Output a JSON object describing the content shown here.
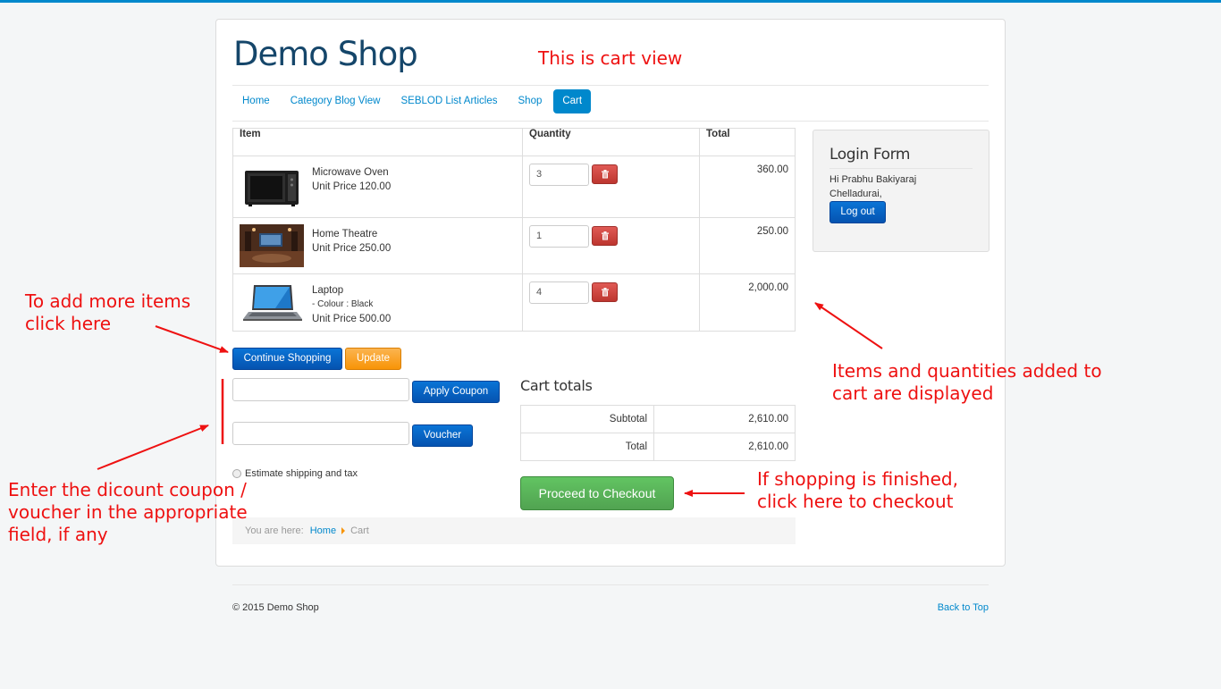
{
  "site": {
    "brand": "Demo Shop"
  },
  "nav": [
    "Home",
    "Category Blog View",
    "SEBLOD List Articles",
    "Shop",
    "Cart"
  ],
  "cart": {
    "headers": {
      "item": "Item",
      "quantity": "Quantity",
      "total": "Total"
    },
    "rows": [
      {
        "name": "Microwave Oven",
        "option": "",
        "unit_price": "Unit Price 120.00",
        "qty": "3",
        "total": "360.00"
      },
      {
        "name": "Home Theatre",
        "option": "",
        "unit_price": "Unit Price 250.00",
        "qty": "1",
        "total": "250.00"
      },
      {
        "name": "Laptop",
        "option": "- Colour : Black",
        "unit_price": "Unit Price 500.00",
        "qty": "4",
        "total": "2,000.00"
      }
    ]
  },
  "buttons": {
    "continue": "Continue Shopping",
    "update": "Update",
    "apply_coupon": "Apply Coupon",
    "voucher": "Voucher",
    "checkout": "Proceed to Checkout",
    "logout": "Log out"
  },
  "estimate": "Estimate shipping and tax",
  "totals": {
    "heading": "Cart totals",
    "subtotal_label": "Subtotal",
    "subtotal": "2,610.00",
    "total_label": "Total",
    "total": "2,610.00"
  },
  "breadcrumb": {
    "prefix": "You are here:",
    "home": "Home",
    "current": "Cart"
  },
  "login": {
    "title": "Login Form",
    "greeting_line1": "Hi Prabhu Bakiyaraj",
    "greeting_line2": "Chelladurai,"
  },
  "footer": {
    "copyright": "© 2015 Demo Shop",
    "back_to_top": "Back to Top"
  },
  "annotations": {
    "cart_view": "This is cart view",
    "more_items_1": "To add more items",
    "more_items_2": "click here",
    "items_1": "Items and quantities added to",
    "items_2": "cart are displayed",
    "coupon_1": "Enter the dicount coupon /",
    "coupon_2": "voucher in the appropriate",
    "coupon_3": "field, if any",
    "checkout_1": "If shopping is finished,",
    "checkout_2": "click here to checkout"
  },
  "colors": {
    "accent": "#0088cc",
    "annotation": "#ee1111",
    "checkout": "#51a351",
    "update": "#f89406"
  }
}
